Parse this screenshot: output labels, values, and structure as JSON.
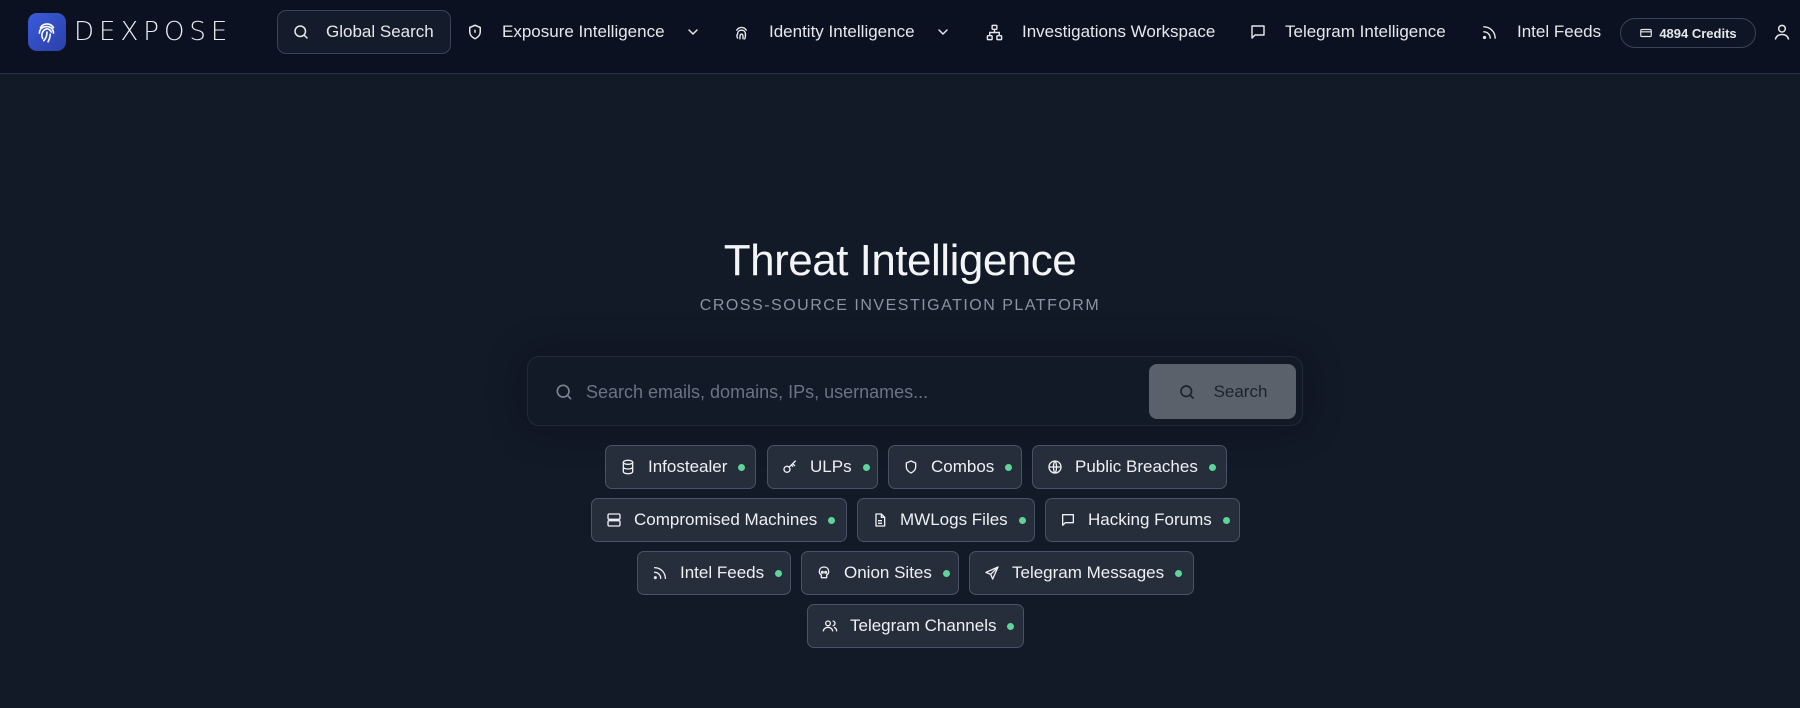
{
  "brand": {
    "name": "DEXPOSE",
    "accent": "#3b5bdb"
  },
  "nav": {
    "global_search": "Global Search",
    "exposure": "Exposure Intelligence",
    "identity": "Identity Intelligence",
    "investigations": "Investigations Workspace",
    "telegram": "Telegram Intelligence",
    "intel_feeds": "Intel Feeds",
    "credits": "4894 Credits"
  },
  "hero": {
    "title": "Threat Intelligence",
    "subtitle": "CROSS-SOURCE INVESTIGATION PLATFORM"
  },
  "search": {
    "placeholder": "Search emails, domains, IPs, usernames...",
    "value": "",
    "button_label": "Search"
  },
  "sources": {
    "status_color": "#5fd49a",
    "items": [
      {
        "label": "Infostealer",
        "icon": "database-icon",
        "status": "online"
      },
      {
        "label": "ULPs",
        "icon": "key-icon",
        "status": "online"
      },
      {
        "label": "Combos",
        "icon": "shield-icon",
        "status": "online"
      },
      {
        "label": "Public Breaches",
        "icon": "globe-icon",
        "status": "online"
      },
      {
        "label": "Compromised Machines",
        "icon": "server-icon",
        "status": "online"
      },
      {
        "label": "MWLogs Files",
        "icon": "file-icon",
        "status": "online"
      },
      {
        "label": "Hacking Forums",
        "icon": "message-icon",
        "status": "online"
      },
      {
        "label": "Intel Feeds",
        "icon": "rss-icon",
        "status": "online"
      },
      {
        "label": "Onion Sites",
        "icon": "skull-icon",
        "status": "online"
      },
      {
        "label": "Telegram Messages",
        "icon": "send-icon",
        "status": "online"
      },
      {
        "label": "Telegram Channels",
        "icon": "users-icon",
        "status": "online"
      }
    ]
  }
}
